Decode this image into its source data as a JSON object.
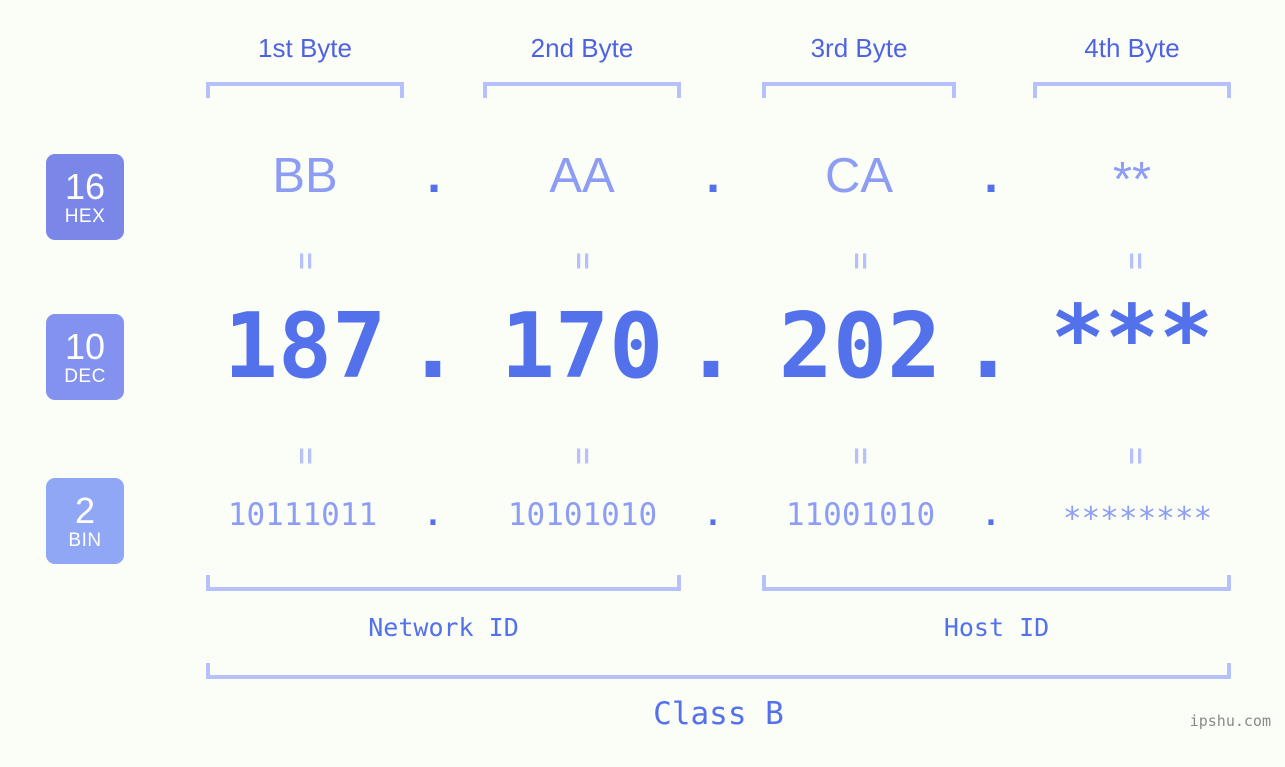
{
  "background_color": "#fbfdf7",
  "accent_color": "#5271ea",
  "light_accent_color": "#8d9df4",
  "bracket_color": "#b6c0fb",
  "byte_headers": [
    {
      "label": "1st Byte"
    },
    {
      "label": "2nd Byte"
    },
    {
      "label": "3rd Byte"
    },
    {
      "label": "4th Byte"
    }
  ],
  "rows": [
    {
      "badge_number": "16",
      "badge_name": "HEX",
      "badge_color": "#7b87e8",
      "values": [
        "BB",
        "AA",
        "CA",
        "**"
      ],
      "separator": "."
    },
    {
      "badge_number": "10",
      "badge_name": "DEC",
      "badge_color": "#8391ef",
      "values": [
        "187",
        "170",
        "202",
        "***"
      ],
      "separator": "."
    },
    {
      "badge_number": "2",
      "badge_name": "BIN",
      "badge_color": "#8fa7f5",
      "values": [
        "10111011",
        "10101010",
        "11001010",
        "********"
      ],
      "separator": "."
    }
  ],
  "equality_mark": "=",
  "segments": {
    "network_id": "Network ID",
    "host_id": "Host ID"
  },
  "class_label": "Class B",
  "watermark": "ipshu.com"
}
